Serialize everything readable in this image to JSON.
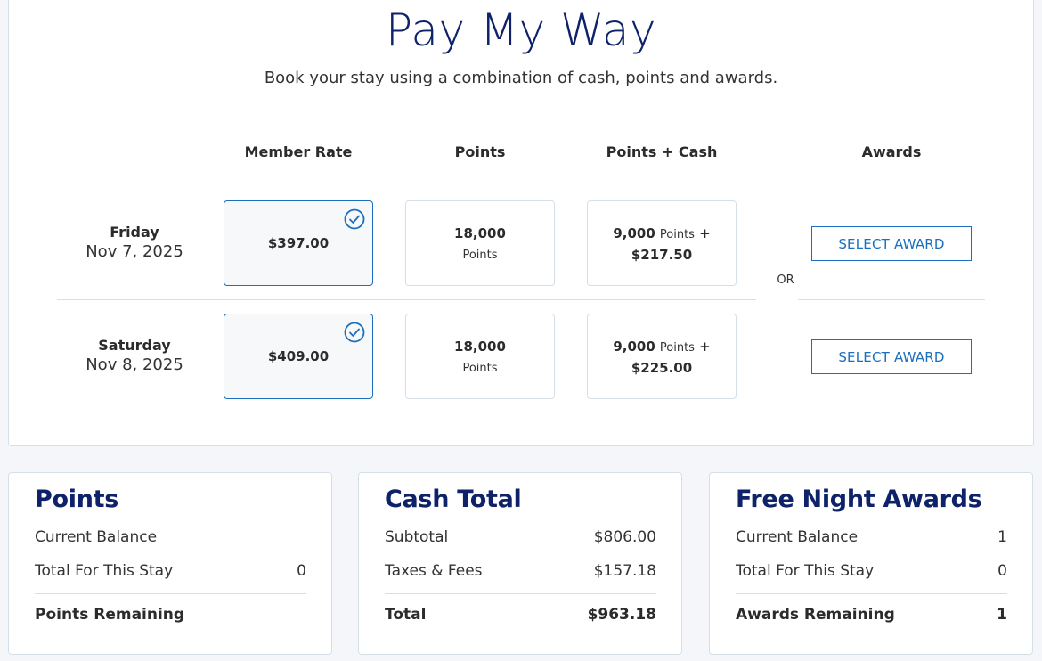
{
  "header": {
    "title": "Pay My Way",
    "subtitle": "Book your stay using a combination of cash, points and awards."
  },
  "columns": {
    "member_rate": "Member Rate",
    "points": "Points",
    "points_cash": "Points + Cash",
    "awards": "Awards"
  },
  "nights": [
    {
      "day": "Friday",
      "date": "Nov 7, 2025",
      "member_rate": "$397.00",
      "member_rate_selected": true,
      "points_value": "18,000",
      "points_unit": "Points",
      "pc_points": "9,000",
      "pc_points_unit": "Points",
      "pc_plus": "+",
      "pc_cash": "$217.50",
      "award_button": "SELECT AWARD"
    },
    {
      "day": "Saturday",
      "date": "Nov 8, 2025",
      "member_rate": "$409.00",
      "member_rate_selected": true,
      "points_value": "18,000",
      "points_unit": "Points",
      "pc_points": "9,000",
      "pc_points_unit": "Points",
      "pc_plus": "+",
      "pc_cash": "$225.00",
      "award_button": "SELECT AWARD"
    }
  ],
  "or_label": "OR",
  "icons": {
    "selected": "check-circle-icon"
  },
  "colors": {
    "brand_navy": "#0d2269",
    "accent_blue": "#1a6fbe",
    "border": "#d5dfe8",
    "page_bg": "#f4f6f9"
  },
  "summary": {
    "points": {
      "title": "Points",
      "rows": [
        {
          "label": "Current Balance",
          "value": ""
        },
        {
          "label": "Total For This Stay",
          "value": "0"
        }
      ],
      "total": {
        "label": "Points Remaining",
        "value": ""
      }
    },
    "cash": {
      "title": "Cash Total",
      "rows": [
        {
          "label": "Subtotal",
          "value": "$806.00"
        },
        {
          "label": "Taxes & Fees",
          "value": "$157.18"
        }
      ],
      "total": {
        "label": "Total",
        "value": "$963.18"
      }
    },
    "awards": {
      "title": "Free Night Awards",
      "rows": [
        {
          "label": "Current Balance",
          "value": "1"
        },
        {
          "label": "Total For This Stay",
          "value": "0"
        }
      ],
      "total": {
        "label": "Awards Remaining",
        "value": "1"
      }
    }
  }
}
